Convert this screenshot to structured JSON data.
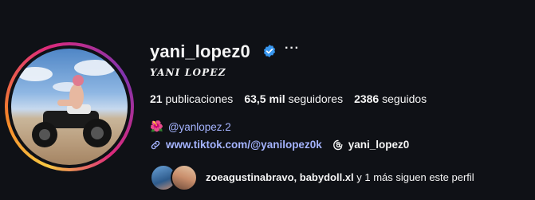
{
  "profile": {
    "username": "yani_lopez0",
    "full_name": "YANI LOPEZ",
    "more_icon": "···",
    "verified_color": "#3897f0"
  },
  "stats": {
    "posts_count": "21",
    "posts_label": "publicaciones",
    "followers_count": "63,5 mil",
    "followers_label": "seguidores",
    "following_count": "2386",
    "following_label": "seguidos"
  },
  "bio": {
    "threads_emoji": "🌺",
    "threads_handle": "@yanlopez.2",
    "link_icon": "link-icon",
    "tiktok_url": "www.tiktok.com/@yanilopez0k",
    "threads_icon": "threads-icon",
    "threads_name": "yani_lopez0"
  },
  "followed_by": {
    "names": "zoeagustinabravo, babydoll.xl",
    "suffix": " y 1 más siguen este perfil"
  },
  "colors": {
    "background": "#0f1116",
    "link": "#a5b4ff"
  }
}
